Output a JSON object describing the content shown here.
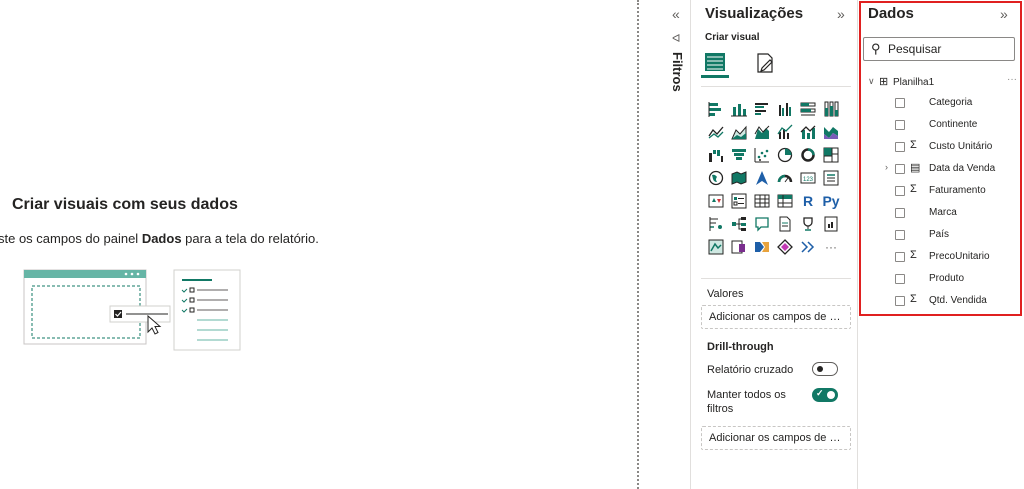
{
  "canvas": {
    "title": "Criar visuais com seus dados",
    "desc_pre": "ste os campos do painel ",
    "desc_bold": "Dados",
    "desc_post": " para a tela do relatório."
  },
  "filters": {
    "label": "Filtros",
    "expand_icon": "«",
    "funnel_icon": "ᐊ"
  },
  "visualizations": {
    "title": "Visualizações",
    "collapse_icon": "»",
    "build_visual_label": "Criar visual",
    "icons": [
      "stacked-bar-chart-icon",
      "stacked-column-chart-icon",
      "clustered-bar-chart-icon",
      "clustered-column-chart-icon",
      "100-stacked-bar-chart-icon",
      "100-stacked-column-chart-icon",
      "line-chart-icon",
      "area-chart-icon",
      "stacked-area-chart-icon",
      "line-and-column-chart-icon",
      "line-and-stacked-column-chart-icon",
      "ribbon-chart-icon",
      "waterfall-chart-icon",
      "funnel-chart-icon",
      "scatter-chart-icon",
      "pie-chart-icon",
      "donut-chart-icon",
      "treemap-icon",
      "map-icon",
      "filled-map-icon",
      "azure-map-icon",
      "gauge-icon",
      "card-icon",
      "multi-row-card-icon",
      "kpi-icon",
      "slicer-icon",
      "table-icon",
      "matrix-icon",
      "r-visual-icon",
      "python-visual-icon",
      "key-influencers-icon",
      "decomposition-tree-icon",
      "qa-icon",
      "smart-narrative-icon",
      "metrics-icon",
      "paginated-report-icon",
      "arcgis-map-icon",
      "power-apps-icon",
      "power-automate-icon",
      "custom-visual-icon",
      "more-visuals-icon",
      "ellipsis-icon"
    ],
    "values_label": "Valores",
    "values_placeholder": "Adicionar os campos de da...",
    "drill_title": "Drill-through",
    "cross_report_label": "Relatório cruzado",
    "keep_filters_label_1": "Manter todos os",
    "keep_filters_label_2": "filtros",
    "drill_placeholder": "Adicionar os campos de dr...",
    "r_label": "R",
    "py_label": "Py",
    "more_label": "···"
  },
  "data_pane": {
    "title": "Dados",
    "collapse_icon": "»",
    "search_placeholder": "Pesquisar",
    "table_name": "Planilha1",
    "table_more": "···",
    "fields": [
      {
        "name": "Categoria",
        "icon": "",
        "expand": ""
      },
      {
        "name": "Continente",
        "icon": "",
        "expand": ""
      },
      {
        "name": "Custo Unitário",
        "icon": "Σ",
        "expand": ""
      },
      {
        "name": "Data da Venda",
        "icon": "▤",
        "expand": "›"
      },
      {
        "name": "Faturamento",
        "icon": "Σ",
        "expand": ""
      },
      {
        "name": "Marca",
        "icon": "",
        "expand": ""
      },
      {
        "name": "País",
        "icon": "",
        "expand": ""
      },
      {
        "name": "PrecoUnitario",
        "icon": "Σ",
        "expand": ""
      },
      {
        "name": "Produto",
        "icon": "",
        "expand": ""
      },
      {
        "name": "Qtd. Vendida",
        "icon": "Σ",
        "expand": ""
      }
    ]
  },
  "colors": {
    "accent": "#117865",
    "highlight": "#e02020",
    "python_blue": "#1e5fa8"
  }
}
